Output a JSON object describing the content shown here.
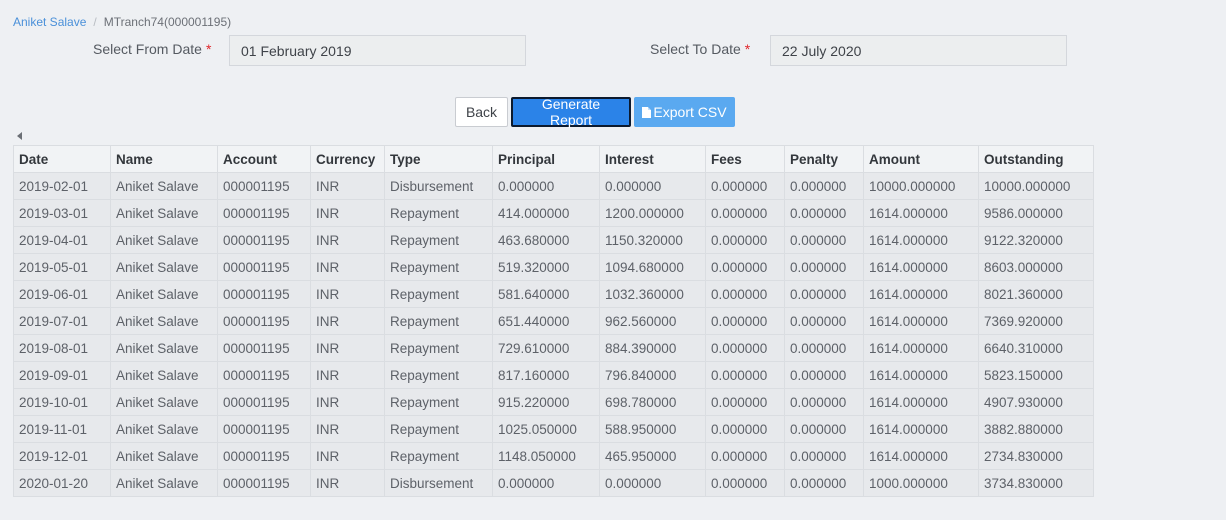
{
  "breadcrumb": {
    "link": "Aniket Salave",
    "current": "MTranch74(000001195)"
  },
  "filters": {
    "from_label": "Select From Date",
    "from_value": "01 February 2019",
    "to_label": "Select To Date",
    "to_value": "22 July 2020",
    "required_mark": "*"
  },
  "actions": {
    "back_label": "Back",
    "generate_label": "Generate Report",
    "export_label": "Export CSV"
  },
  "table": {
    "columns": [
      "Date",
      "Name",
      "Account",
      "Currency",
      "Type",
      "Principal",
      "Interest",
      "Fees",
      "Penalty",
      "Amount",
      "Outstanding"
    ],
    "rows": [
      [
        "2019-02-01",
        "Aniket Salave",
        "000001195",
        "INR",
        "Disbursement",
        "0.000000",
        "0.000000",
        "0.000000",
        "0.000000",
        "10000.000000",
        "10000.000000"
      ],
      [
        "2019-03-01",
        "Aniket Salave",
        "000001195",
        "INR",
        "Repayment",
        "414.000000",
        "1200.000000",
        "0.000000",
        "0.000000",
        "1614.000000",
        "9586.000000"
      ],
      [
        "2019-04-01",
        "Aniket Salave",
        "000001195",
        "INR",
        "Repayment",
        "463.680000",
        "1150.320000",
        "0.000000",
        "0.000000",
        "1614.000000",
        "9122.320000"
      ],
      [
        "2019-05-01",
        "Aniket Salave",
        "000001195",
        "INR",
        "Repayment",
        "519.320000",
        "1094.680000",
        "0.000000",
        "0.000000",
        "1614.000000",
        "8603.000000"
      ],
      [
        "2019-06-01",
        "Aniket Salave",
        "000001195",
        "INR",
        "Repayment",
        "581.640000",
        "1032.360000",
        "0.000000",
        "0.000000",
        "1614.000000",
        "8021.360000"
      ],
      [
        "2019-07-01",
        "Aniket Salave",
        "000001195",
        "INR",
        "Repayment",
        "651.440000",
        "962.560000",
        "0.000000",
        "0.000000",
        "1614.000000",
        "7369.920000"
      ],
      [
        "2019-08-01",
        "Aniket Salave",
        "000001195",
        "INR",
        "Repayment",
        "729.610000",
        "884.390000",
        "0.000000",
        "0.000000",
        "1614.000000",
        "6640.310000"
      ],
      [
        "2019-09-01",
        "Aniket Salave",
        "000001195",
        "INR",
        "Repayment",
        "817.160000",
        "796.840000",
        "0.000000",
        "0.000000",
        "1614.000000",
        "5823.150000"
      ],
      [
        "2019-10-01",
        "Aniket Salave",
        "000001195",
        "INR",
        "Repayment",
        "915.220000",
        "698.780000",
        "0.000000",
        "0.000000",
        "1614.000000",
        "4907.930000"
      ],
      [
        "2019-11-01",
        "Aniket Salave",
        "000001195",
        "INR",
        "Repayment",
        "1025.050000",
        "588.950000",
        "0.000000",
        "0.000000",
        "1614.000000",
        "3882.880000"
      ],
      [
        "2019-12-01",
        "Aniket Salave",
        "000001195",
        "INR",
        "Repayment",
        "1148.050000",
        "465.950000",
        "0.000000",
        "0.000000",
        "1614.000000",
        "2734.830000"
      ],
      [
        "2020-01-20",
        "Aniket Salave",
        "000001195",
        "INR",
        "Disbursement",
        "0.000000",
        "0.000000",
        "0.000000",
        "0.000000",
        "1000.000000",
        "3734.830000"
      ]
    ]
  }
}
